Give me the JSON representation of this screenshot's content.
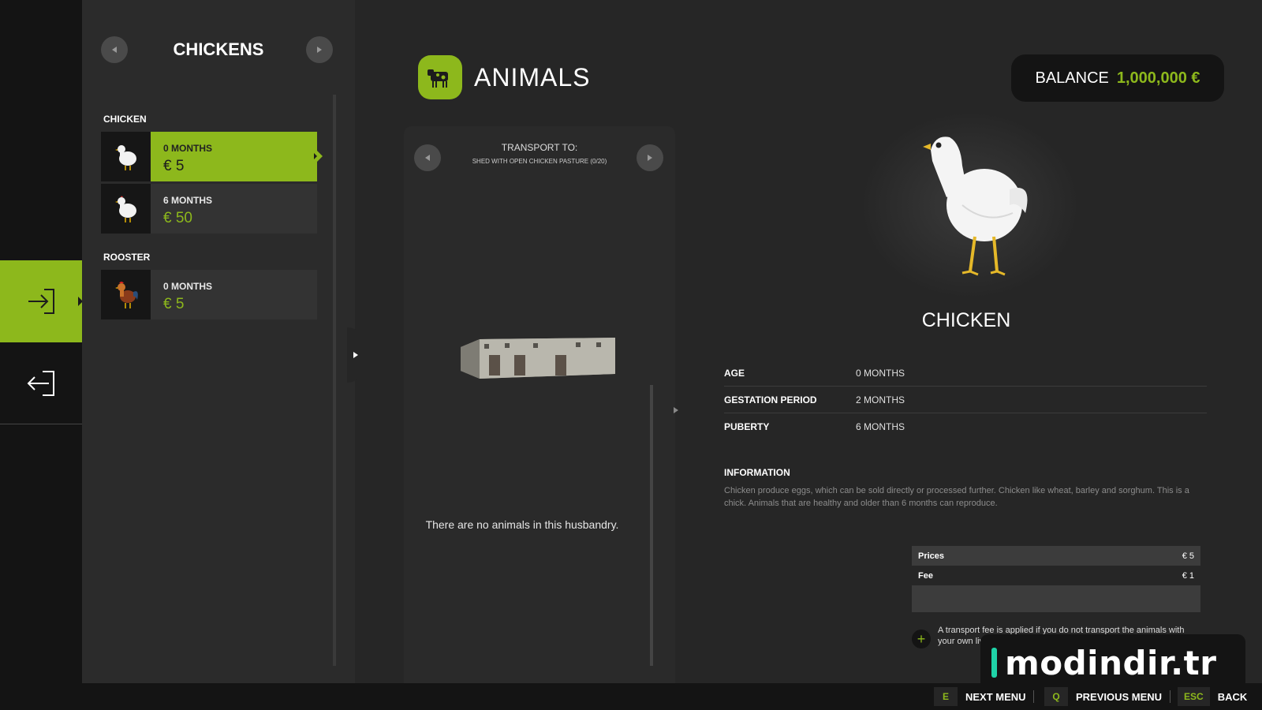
{
  "list": {
    "title": "CHICKENS",
    "groups": [
      {
        "label": "CHICKEN",
        "items": [
          {
            "age": "0 MONTHS",
            "price": "€ 5",
            "selected": true
          },
          {
            "age": "6 MONTHS",
            "price": "€ 50",
            "selected": false
          }
        ]
      },
      {
        "label": "ROOSTER",
        "items": [
          {
            "age": "0 MONTHS",
            "price": "€ 5",
            "selected": false
          }
        ]
      }
    ]
  },
  "header": {
    "title": "ANIMALS"
  },
  "balance": {
    "label": "BALANCE",
    "value": "1,000,000 €"
  },
  "transport": {
    "label": "TRANSPORT TO:",
    "destination": "SHED WITH OPEN CHICKEN PASTURE (0/20)",
    "empty_message": "There are no animals in this husbandry."
  },
  "detail": {
    "name": "CHICKEN",
    "stats": [
      {
        "label": "AGE",
        "value": "0 MONTHS"
      },
      {
        "label": "GESTATION PERIOD",
        "value": "2 MONTHS"
      },
      {
        "label": "PUBERTY",
        "value": "6 MONTHS"
      }
    ],
    "info_label": "INFORMATION",
    "info_text": "Chicken produce eggs, which can be sold directly or processed further. Chicken like wheat, barley and sorghum. This is a chick. Animals that are healthy and older than 6 months can reproduce.",
    "fees": [
      {
        "label": "Prices",
        "value": "€ 5"
      },
      {
        "label": "Fee",
        "value": "€ 1"
      }
    ],
    "fee_note": "A transport fee is applied if you do not transport the animals with your own livestock trailer!"
  },
  "watermark": {
    "text": "modindir.tr"
  },
  "footer": {
    "hints": [
      {
        "key": "E",
        "label": "NEXT MENU"
      },
      {
        "key": "Q",
        "label": "PREVIOUS MENU"
      },
      {
        "key": "ESC",
        "label": "BACK"
      }
    ]
  },
  "colors": {
    "accent": "#8db81c",
    "background": "#262626",
    "panel": "#2b2b2b",
    "watermark_accent": "#1fd3a8"
  }
}
